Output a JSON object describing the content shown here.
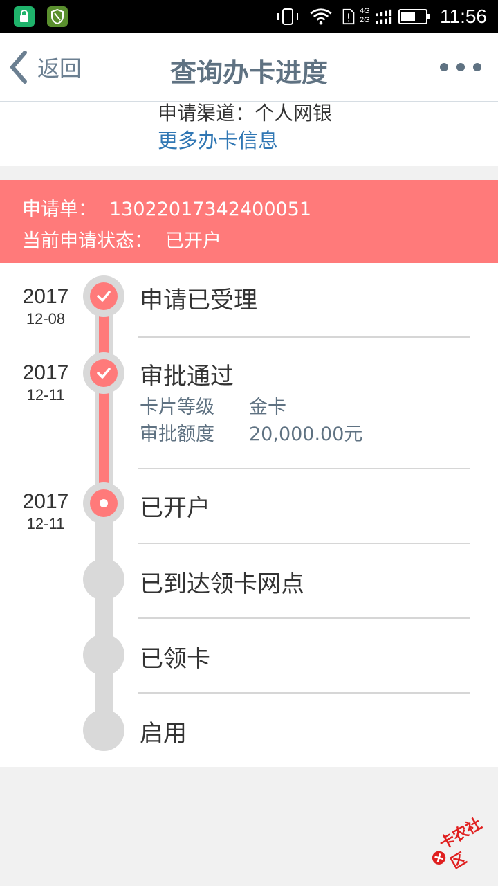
{
  "status_bar": {
    "time": "11:56",
    "network_top": "4G",
    "network_bottom": "2G",
    "icons": [
      "lock-icon",
      "shield-icon",
      "vibrate-icon",
      "wifi-icon",
      "sim-icon",
      "signal-icon",
      "battery-icon"
    ]
  },
  "header": {
    "back_label": "返回",
    "title": "查询办卡进度",
    "more_icon": "more-dots-icon"
  },
  "info": {
    "channel_label": "申请渠道：",
    "channel_value": "个人网银",
    "more_link": "更多办卡信息"
  },
  "banner": {
    "order_label": "申请单：",
    "order_value": "13022017342400051",
    "status_label": "当前申请状态：",
    "status_value": "已开户"
  },
  "timeline": {
    "steps": [
      {
        "year": "2017",
        "date": "12-08",
        "label": "申请已受理",
        "state": "done"
      },
      {
        "year": "2017",
        "date": "12-11",
        "label": "审批通过",
        "state": "done",
        "details": [
          {
            "label": "卡片等级",
            "value": "金卡"
          },
          {
            "label": "审批额度",
            "value": "20,000.00元"
          }
        ]
      },
      {
        "year": "2017",
        "date": "12-11",
        "label": "已开户",
        "state": "current"
      },
      {
        "label": "已到达领卡网点",
        "state": "pending"
      },
      {
        "label": "已领卡",
        "state": "pending"
      },
      {
        "label": "启用",
        "state": "pending"
      }
    ]
  },
  "watermark": "卡农社区",
  "colors": {
    "accent_red": "#ff7a7a",
    "header_text": "#5f7282",
    "link_blue": "#3077b4",
    "track_grey": "#d9d9d9"
  }
}
